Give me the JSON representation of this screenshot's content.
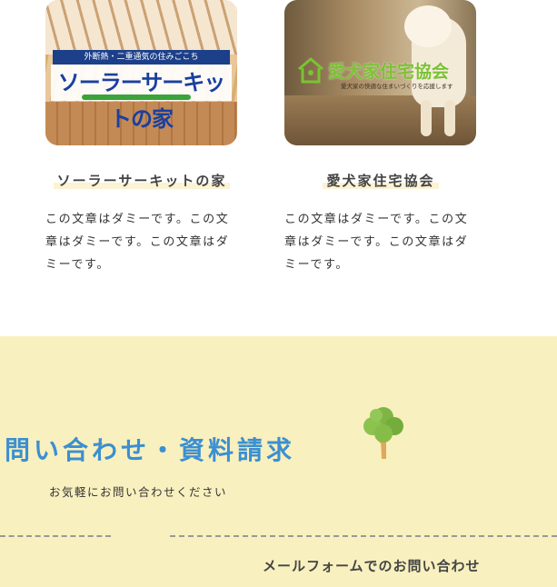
{
  "cards": [
    {
      "image": {
        "band_text": "外断熱・二重通気の住みごこち",
        "logo_text": "ソーラーサーキットの家"
      },
      "title": "ソーラーサーキットの家",
      "description": "この文章はダミーです。この文章はダミーです。この文章はダミーです。"
    },
    {
      "image": {
        "logo_title": "愛犬家住宅協会",
        "logo_sub": "愛犬家の快適な住まいづくりを応援します"
      },
      "title": "愛犬家住宅協会",
      "description": "この文章はダミーです。この文章はダミーです。この文章はダミーです。"
    }
  ],
  "contact": {
    "heading": "問い合わせ・資料請求",
    "subtext": "お気軽にお問い合わせください",
    "form_link": "メールフォームでのお問い合わせ",
    "background": "#f8f0bf",
    "heading_color": "#3c8fd0",
    "icon": "tree-icon"
  }
}
